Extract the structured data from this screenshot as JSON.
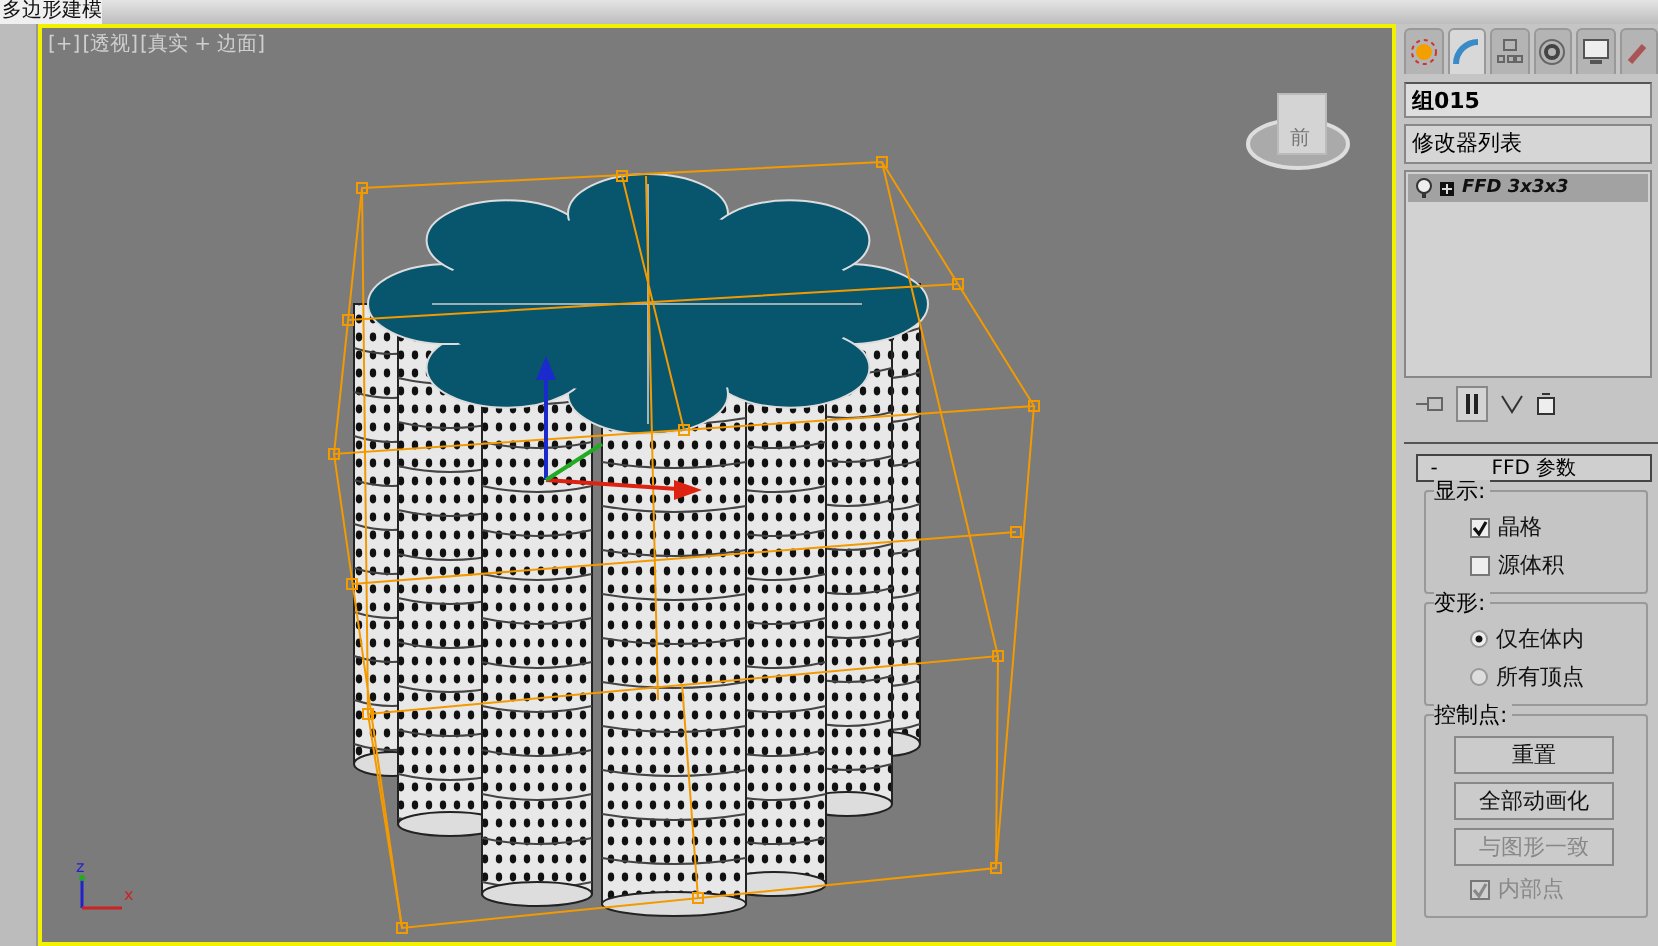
{
  "title_bar": {
    "title": "多边形建模"
  },
  "viewport": {
    "labels": [
      "[+]",
      "[透视]",
      "[真实 + 边面]"
    ],
    "viewcube_label": "前",
    "axis_labels": [
      "z",
      "x"
    ]
  },
  "command_panel": {
    "tabs": [
      {
        "kind": "create",
        "selected": false
      },
      {
        "kind": "modify",
        "selected": true
      },
      {
        "kind": "hierarchy",
        "selected": false
      },
      {
        "kind": "motion",
        "selected": false
      },
      {
        "kind": "display",
        "selected": false
      },
      {
        "kind": "utilities",
        "selected": false
      }
    ],
    "object_name": "组015",
    "modifier_list": "修改器列表",
    "stack": [
      {
        "label": "FFD 3x3x3",
        "selected": true
      }
    ],
    "rollout": {
      "collapse": "-",
      "title": "FFD 参数",
      "groups": [
        {
          "title": "显示:",
          "items": [
            {
              "kind": "checkbox",
              "label": "晶格",
              "checked": true,
              "disabled": false
            },
            {
              "kind": "checkbox",
              "label": "源体积",
              "checked": false,
              "disabled": false
            }
          ]
        },
        {
          "title": "变形:",
          "items": [
            {
              "kind": "radio",
              "label": "仅在体内",
              "selected": true
            },
            {
              "kind": "radio",
              "label": "所有顶点",
              "selected": false
            }
          ]
        },
        {
          "title": "控制点:",
          "items": [
            {
              "kind": "button",
              "label": "重置",
              "disabled": false
            },
            {
              "kind": "button",
              "label": "全部动画化",
              "disabled": false
            },
            {
              "kind": "button",
              "label": "与图形一致",
              "disabled": true
            },
            {
              "kind": "checkbox",
              "label": "内部点",
              "checked": true,
              "disabled": true
            }
          ]
        }
      ]
    }
  }
}
